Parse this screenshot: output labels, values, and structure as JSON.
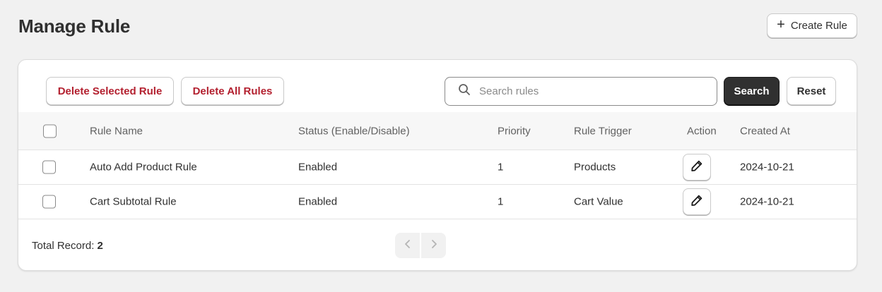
{
  "header": {
    "title": "Manage Rule",
    "create_label": "Create Rule"
  },
  "toolbar": {
    "delete_selected_label": "Delete Selected Rule",
    "delete_all_label": "Delete All Rules",
    "search_placeholder": "Search rules",
    "search_value": "",
    "search_label": "Search",
    "reset_label": "Reset"
  },
  "table": {
    "columns": [
      "Rule Name",
      "Status (Enable/Disable)",
      "Priority",
      "Rule Trigger",
      "Action",
      "Created At"
    ],
    "rows": [
      {
        "name": "Auto Add Product Rule",
        "status": "Enabled",
        "priority": "1",
        "trigger": "Products",
        "created_at": "2024-10-21",
        "selected": false
      },
      {
        "name": "Cart Subtotal Rule",
        "status": "Enabled",
        "priority": "1",
        "trigger": "Cart Value",
        "created_at": "2024-10-21",
        "selected": false
      }
    ]
  },
  "footer": {
    "total_label": "Total Record:",
    "total_count": "2"
  },
  "icons": {
    "create": "plus-icon",
    "search": "search-icon",
    "edit": "pencil-icon",
    "prev": "chevron-left-icon",
    "next": "chevron-right-icon"
  },
  "colors": {
    "danger_text": "#b3202f",
    "primary_button": "#303030",
    "page_background": "#f1f1f1"
  }
}
